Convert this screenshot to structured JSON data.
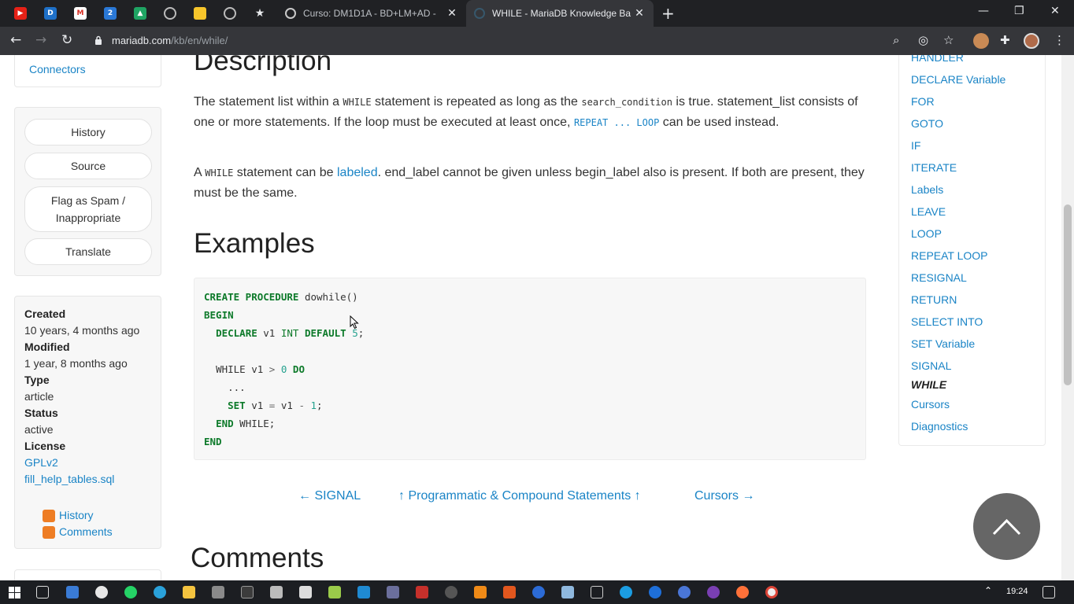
{
  "browser": {
    "tabs": [
      {
        "title": "Curso: DM1D1A - BD+LM+AD - ",
        "active": false
      },
      {
        "title": "WHILE - MariaDB Knowledge Ba",
        "active": true
      }
    ],
    "url_host": "mariadb.com",
    "url_path": "/kb/en/while/"
  },
  "sidebar": {
    "top_link": "Connectors",
    "actions": [
      "History",
      "Source",
      "Flag as Spam / Inappropriate",
      "Translate"
    ],
    "meta": {
      "created_label": "Created",
      "created_value": "10 years, 4 months ago",
      "modified_label": "Modified",
      "modified_value": "1 year, 8 months ago",
      "type_label": "Type",
      "type_value": "article",
      "status_label": "Status",
      "status_value": "active",
      "license_label": "License",
      "license_links": [
        "GPLv2",
        "fill_help_tables.sql"
      ]
    },
    "feeds": [
      "History",
      "Comments"
    ]
  },
  "content": {
    "description_heading": "Description",
    "p1": {
      "t1": "The statement list within a ",
      "c1": "WHILE",
      "t2": " statement is repeated as long as the ",
      "c2": "search_condition",
      "t3": " is true. statement_list consists of one or more statements. If the loop must be executed at least once, ",
      "c3": "REPEAT ... LOOP",
      "t4": " can be used instead."
    },
    "p2": {
      "t1": "A ",
      "c1": "WHILE",
      "t2": " statement can be ",
      "link": "labeled",
      "t3": ". end_label cannot be given unless begin_label also is present. If both are present, they must be the same."
    },
    "examples_heading": "Examples",
    "code": {
      "l1_kw": "CREATE PROCEDURE",
      "l1_rest": " dowhile()",
      "l2_kw": "BEGIN",
      "l3_kw": "DECLARE",
      "l3_a": " v1 ",
      "l3_ty": "INT",
      "l3_kw2": "DEFAULT",
      "l3_num": "5",
      "l3_end": ";",
      "l5_a": "WHILE v1 ",
      "l5_op": ">",
      "l5_num": "0",
      "l5_kw": "DO",
      "l6": "...",
      "l7_kw": "SET",
      "l7_a": " v1 ",
      "l7_op": "=",
      "l7_b": " v1 ",
      "l7_op2": "-",
      "l7_num": "1",
      "l7_end": ";",
      "l8_kw": "END",
      "l8_a": " WHILE;",
      "l9_kw": "END"
    },
    "prev_link": "← SIGNAL",
    "up_link": "↑ Programmatic & Compound Statements ↑",
    "next_link": "Cursors →",
    "comments_heading": "Comments"
  },
  "right_nav": {
    "partial_top": "HANDLER",
    "items": [
      "DECLARE Variable",
      "FOR",
      "GOTO",
      "IF",
      "ITERATE",
      "Labels",
      "LEAVE",
      "LOOP",
      "REPEAT LOOP",
      "RESIGNAL",
      "RETURN",
      "SELECT INTO",
      "SET Variable",
      "SIGNAL"
    ],
    "current": "WHILE",
    "after": [
      "Cursors",
      "Diagnostics"
    ]
  },
  "taskbar": {
    "time": "19:24"
  },
  "colors": {
    "link": "#1a84c6",
    "keyword": "#0d7a2a",
    "number": "#25a18e"
  }
}
